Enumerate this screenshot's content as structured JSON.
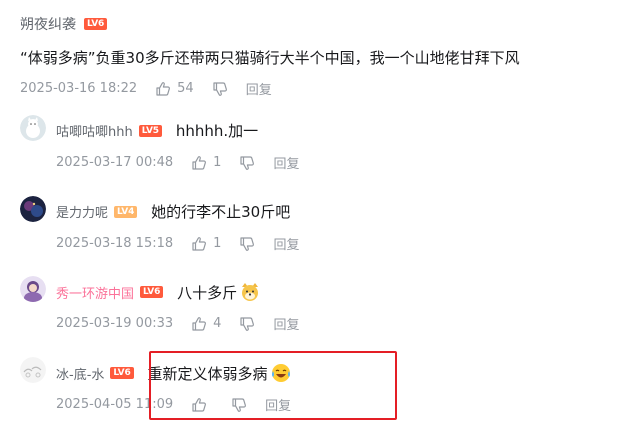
{
  "main": {
    "username": "朔夜纠袭",
    "level": "LV6",
    "text": "“体弱多病”负重30多斤还带两只猫骑行大半个中国，我一个山地佬甘拜下风",
    "date": "2025-03-16 18:22",
    "likes": "54",
    "reply_label": "回复"
  },
  "replies": [
    {
      "username": "咕唧咕唧hhh",
      "level": "LV5",
      "text": "hhhhh.加一",
      "date": "2025-03-17 00:48",
      "likes": "1",
      "reply_label": "回复",
      "emoji": ""
    },
    {
      "username": "是力力呢",
      "level": "LV4",
      "text": "她的行李不止30斤吧",
      "date": "2025-03-18 15:18",
      "likes": "1",
      "reply_label": "回复",
      "emoji": ""
    },
    {
      "username": "秀一环游中国",
      "level": "LV6",
      "text": "八十多斤",
      "date": "2025-03-19 00:33",
      "likes": "4",
      "reply_label": "回复",
      "emoji": "dog-emoji"
    },
    {
      "username": "冰-底-水",
      "level": "LV6",
      "text": "重新定义体弱多病",
      "date": "2025-04-05 11:09",
      "likes": "",
      "reply_label": "回复",
      "emoji": "laugh-cry-emoji"
    }
  ],
  "colors": {
    "level6": "#ff5a3c",
    "level4": "#ffb76b",
    "vip_name": "#fb7299",
    "highlight": "#e41e25",
    "meta_gray": "#9499a0"
  }
}
